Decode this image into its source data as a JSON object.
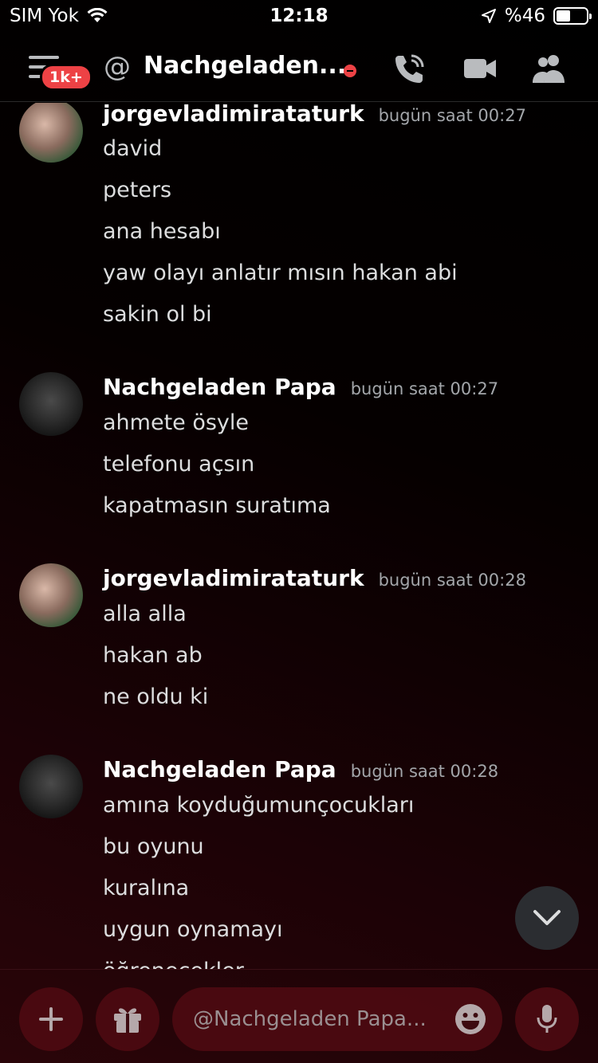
{
  "status_bar": {
    "carrier": "SIM Yok",
    "time": "12:18",
    "battery_text": "%46",
    "battery_level": 0.46
  },
  "header": {
    "unread_badge": "1k+",
    "at_symbol": "@",
    "title": "Nachgeladen..."
  },
  "messages": [
    {
      "author": "jorgevladimirataturk",
      "timestamp": "bugün saat 00:27",
      "lines": [
        "david",
        "peters",
        "ana hesabı",
        "yaw olayı anlatır mısın hakan abi",
        "sakin ol bi"
      ]
    },
    {
      "author": "Nachgeladen Papa",
      "timestamp": "bugün saat 00:27",
      "lines": [
        "ahmete ösyle",
        "telefonu açsın",
        "kapatmasın suratıma"
      ]
    },
    {
      "author": "jorgevladimirataturk",
      "timestamp": "bugün saat 00:28",
      "lines": [
        "alla alla",
        "hakan ab",
        "ne oldu ki"
      ]
    },
    {
      "author": "Nachgeladen Papa",
      "timestamp": "bugün saat 00:28",
      "lines": [
        "amına koyduğumunçocukları",
        "bu oyunu",
        "kuralına",
        "uygun oynamayı",
        "öğrenecekler"
      ]
    }
  ],
  "composer": {
    "placeholder": "@Nachgeladen Papa..."
  },
  "colors": {
    "accent_red": "#ed4245",
    "background": "#000000"
  }
}
